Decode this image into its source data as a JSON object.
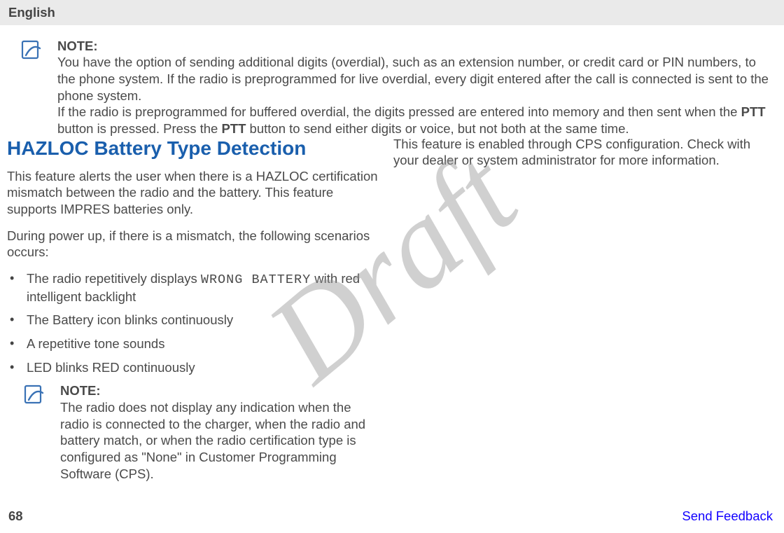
{
  "header": {
    "language": "English"
  },
  "top_note": {
    "label": "NOTE:",
    "p1a": "You have the option of sending additional digits (overdial), such as an extension number, or credit card or PIN numbers, to the phone system. If the radio is preprogrammed for live overdial, every digit entered after the call is connected is sent to the phone system.",
    "p2a": "If the radio is preprogrammed for buffered overdial, the digits pressed are entered into memory and then sent when the ",
    "p2b": "PTT",
    "p2c": " button is pressed. Press the ",
    "p2d": "PTT",
    "p2e": " button to send either digits or voice, but not both at the same time."
  },
  "heading": "HAZLOC Battery Type Detection",
  "para1": "This feature alerts the user when there is a HAZLOC certification mismatch between the radio and the battery. This feature supports IMPRES batteries only.",
  "para2": "During power up, if there is a mismatch, the following scenarios occurs:",
  "bullets": {
    "b1a": "The radio repetitively displays ",
    "b1b": "WRONG BATTERY",
    "b1c": " with red intelligent backlight",
    "b2": "The Battery icon blinks continuously",
    "b3": "A repetitive tone sounds",
    "b4": "LED blinks RED continuously"
  },
  "inner_note": {
    "label": "NOTE:",
    "text": "The radio does not display any indication when the radio is connected to the charger, when the radio and battery match, or when the radio certification type is configured as \"None\" in Customer Programming Software (CPS)."
  },
  "right_col": "This feature is enabled through CPS configuration. Check with your dealer or system administrator for more information.",
  "footer": {
    "page": "68",
    "feedback": "Send Feedback"
  },
  "watermark": "Draft"
}
